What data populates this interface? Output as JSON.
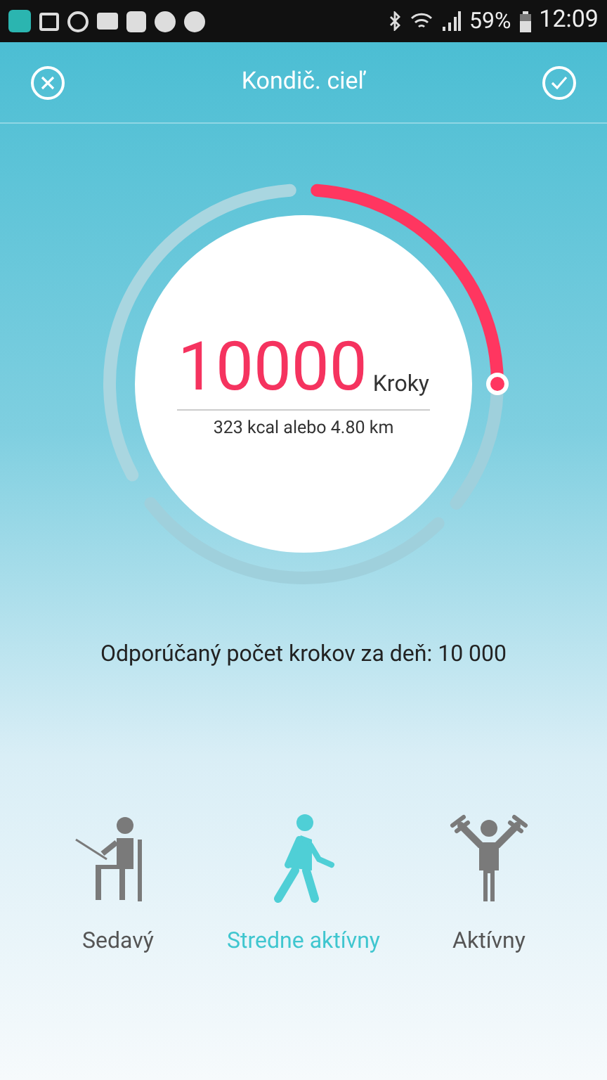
{
  "status_bar": {
    "battery": "59%",
    "time": "12:09"
  },
  "header": {
    "title": "Kondič. cieľ"
  },
  "goal": {
    "value": "10000",
    "unit": "Kroky",
    "detail": "323 kcal alebo 4.80 km"
  },
  "recommendation": "Odporúčaný počet krokov za deň: 10 000",
  "activities": [
    {
      "kind": "sitting",
      "label": "Sedavý",
      "selected": false
    },
    {
      "kind": "walking",
      "label": "Stredne aktívny",
      "selected": true
    },
    {
      "kind": "active",
      "label": "Aktívny",
      "selected": false
    }
  ]
}
